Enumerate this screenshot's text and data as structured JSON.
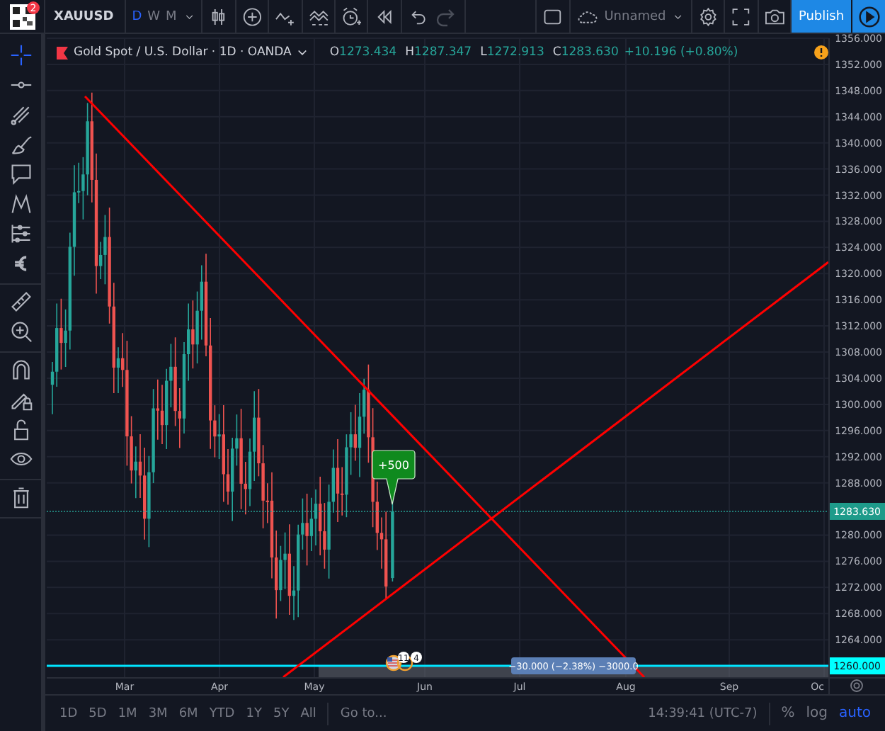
{
  "top_bar": {
    "notification_count": "2",
    "symbol": "XAUUSD",
    "intervals": [
      {
        "label": "D",
        "selected": true
      },
      {
        "label": "W",
        "selected": false
      },
      {
        "label": "M",
        "selected": false
      }
    ],
    "layout_name": "Unnamed",
    "publish": "Publish"
  },
  "left_toolbar": {
    "tool_groups": [
      [
        {
          "kind": "crosshair",
          "selected": true
        },
        {
          "kind": "trendline",
          "selected": false
        },
        {
          "kind": "fork",
          "selected": false
        },
        {
          "kind": "brush",
          "selected": false
        },
        {
          "kind": "note",
          "selected": false
        },
        {
          "kind": "pattern",
          "selected": false
        },
        {
          "kind": "forecast",
          "selected": false
        },
        {
          "kind": "euro",
          "selected": false
        }
      ],
      [
        {
          "kind": "ruler",
          "selected": false
        },
        {
          "kind": "zoom",
          "selected": false
        }
      ],
      [
        {
          "kind": "magnet",
          "selected": false
        },
        {
          "kind": "pencil-lock",
          "selected": false
        },
        {
          "kind": "lock",
          "selected": false
        },
        {
          "kind": "eye",
          "selected": false
        }
      ],
      [
        {
          "kind": "trash",
          "selected": false
        }
      ]
    ]
  },
  "legend": {
    "title": "Gold Spot / U.S. Dollar · 1D · OANDA",
    "ohlc": [
      {
        "key": "O",
        "value": "1273.434"
      },
      {
        "key": "H",
        "value": "1287.347"
      },
      {
        "key": "L",
        "value": "1272.913"
      },
      {
        "key": "C",
        "value": "1283.630"
      }
    ],
    "change": "+10.196 (+0.80%)"
  },
  "chart": {
    "price_ticks": [
      "1356.000",
      "1352.000",
      "1348.000",
      "1344.000",
      "1340.000",
      "1336.000",
      "1332.000",
      "1328.000",
      "1324.000",
      "1320.000",
      "1316.000",
      "1312.000",
      "1308.000",
      "1304.000",
      "1300.000",
      "1296.000",
      "1292.000",
      "1288.000",
      "1280.000",
      "1276.000",
      "1272.000",
      "1268.000",
      "1264.000"
    ],
    "last_price": "1283.630",
    "level_price": "1260.000",
    "time_ticks": [
      "Mar",
      "Apr",
      "May",
      "Jun",
      "Jul",
      "Aug",
      "Sep",
      "Oc"
    ],
    "callout": "+500",
    "range_label": "−30.000 (−2.38%) −3000.0",
    "event_badges": [
      "11",
      "4"
    ]
  },
  "bottom_bar": {
    "ranges": [
      "1D",
      "5D",
      "1M",
      "3M",
      "6M",
      "YTD",
      "1Y",
      "5Y",
      "All"
    ],
    "goto": "Go to...",
    "clock": "14:39:41 (UTC-7)",
    "scale_options": [
      {
        "label": "%",
        "selected": false
      },
      {
        "label": "log",
        "selected": false
      },
      {
        "label": "auto",
        "selected": true
      }
    ]
  }
}
